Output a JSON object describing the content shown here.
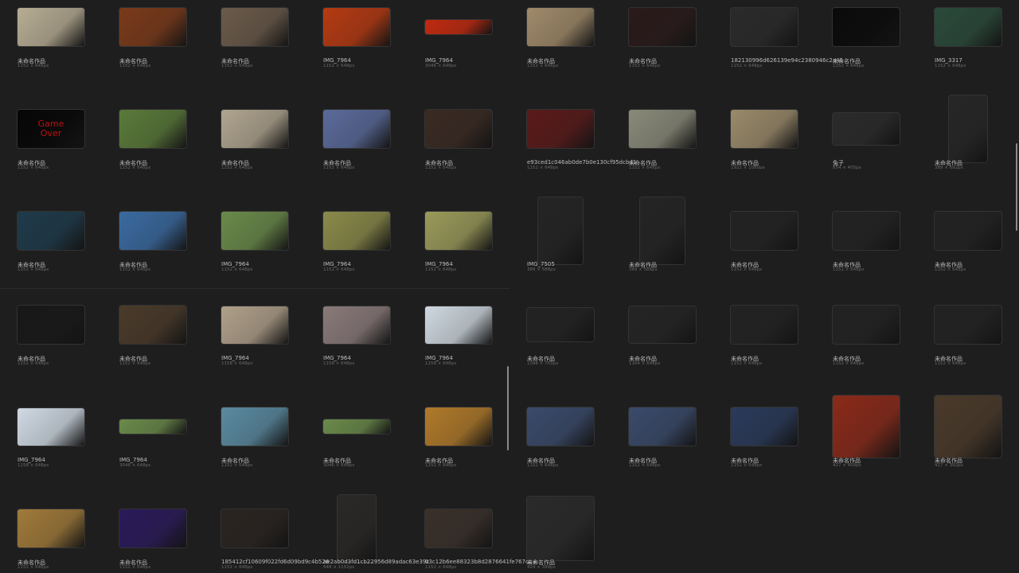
{
  "left_pane": {
    "rows": [
      [
        {
          "name": "未命名作品",
          "dims": "1152 × 648px",
          "color": "#b7ad94"
        },
        {
          "name": "未命名作品",
          "dims": "1152 × 648px",
          "color": "#7a3a1a"
        },
        {
          "name": "未命名作品",
          "dims": "1152 × 648px",
          "color": "#6a5a4a"
        },
        {
          "name": "IMG_7964",
          "dims": "1152 × 648px",
          "color": "#b53a12"
        },
        {
          "name": "IMG_7964",
          "dims": "3046 × 648px",
          "color": "#c02a10"
        }
      ],
      [
        {
          "name": "未命名作品",
          "dims": "1152 × 648px",
          "color": "#060606",
          "caption": "Game\nOver"
        },
        {
          "name": "未命名作品",
          "dims": "1152 × 648px",
          "color": "#5a7a3a"
        },
        {
          "name": "未命名作品",
          "dims": "1152 × 648px",
          "color": "#b0a590"
        },
        {
          "name": "未命名作品",
          "dims": "1152 × 648px",
          "color": "#5a6a9a"
        },
        {
          "name": "未命名作品",
          "dims": "1152 × 648px",
          "color": "#3a2a22"
        }
      ],
      [
        {
          "name": "未命名作品",
          "dims": "1152 × 648px",
          "color": "#1e3a4a"
        },
        {
          "name": "未命名作品",
          "dims": "1152 × 648px",
          "color": "#3a6aa0"
        },
        {
          "name": "IMG_7964",
          "dims": "1152 × 648px",
          "color": "#6a8a4a"
        },
        {
          "name": "IMG_7964",
          "dims": "1152 × 648px",
          "color": "#8a8a4a"
        },
        {
          "name": "IMG_7964",
          "dims": "1152 × 648px",
          "color": "#9a9a5a"
        }
      ],
      [
        {
          "name": "未命名作品",
          "dims": "1152 × 648px",
          "color": "#181818"
        },
        {
          "name": "未命名作品",
          "dims": "1152 × 648px",
          "color": "#4a3a2a"
        },
        {
          "name": "IMG_7964",
          "dims": "1158 × 648px",
          "color": "#b0a08a"
        },
        {
          "name": "IMG_7964",
          "dims": "1158 × 648px",
          "color": "#8a7a7a"
        },
        {
          "name": "IMG_7964",
          "dims": "1158 × 648px",
          "color": "#cfd8e0"
        }
      ],
      [
        {
          "name": "IMG_7964",
          "dims": "1158 × 648px",
          "color": "#d0dae4"
        },
        {
          "name": "IMG_7964",
          "dims": "3046 × 648px",
          "color": "#6a8a4a"
        },
        {
          "name": "未命名作品",
          "dims": "1152 × 648px",
          "color": "#5a8aa0"
        },
        {
          "name": "未命名作品",
          "dims": "3046 × 648px",
          "color": "#6a8a4a"
        },
        {
          "name": "未命名作品",
          "dims": "1152 × 648px",
          "color": "#b07a2a"
        }
      ],
      [
        {
          "name": "未命名作品",
          "dims": "1152 × 648px",
          "color": "#a07a3a"
        },
        {
          "name": "未命名作品",
          "dims": "1152 × 648px",
          "color": "#2a1a5a"
        },
        {
          "name": "185412cf10609f022fd6d09bd9c4b526",
          "dims": "1152 × 648px",
          "color": "#2a2420"
        },
        {
          "name": "ae2ab0d3fd1cb22956d89adac63e39c",
          "dims": "648 × 1152px",
          "color": "#2a2826"
        },
        {
          "name": "03c12b6ee88323b8d2876641fe767d29",
          "dims": "1152 × 648px",
          "color": "#3a302a"
        }
      ]
    ]
  },
  "right_pane": {
    "rows": [
      [
        {
          "name": "未命名作品",
          "dims": "1152 × 648px",
          "color": "#a08a6a"
        },
        {
          "name": "未命名作品",
          "dims": "1152 × 648px",
          "color": "#2a1a1a"
        },
        {
          "name": "182130996d626139e94c2380946c2a40",
          "dims": "1152 × 648px",
          "color": "#2a2a2a"
        },
        {
          "name": "未命名作品",
          "dims": "1152 × 648px",
          "color": "#0a0a0a"
        },
        {
          "name": "IMG_3317",
          "dims": "1152 × 648px",
          "color": "#2a4a3a"
        }
      ],
      [
        {
          "name": "e93ced1c046ab0de7b0e130cf95dcbd1",
          "dims": "1152 × 648px",
          "color": "#5a1a1a"
        },
        {
          "name": "未命名作品",
          "dims": "1152 × 648px",
          "color": "#8a8a7a"
        },
        {
          "name": "未命名作品",
          "dims": "1922 × 1080px",
          "color": "#9a8a6a"
        },
        {
          "name": "兔子",
          "dims": "854 × 405px",
          "color": "#2a2a2a"
        },
        {
          "name": "未命名作品",
          "dims": "389 × 692px",
          "color": "#262626"
        }
      ],
      [
        {
          "name": "IMG_7505",
          "dims": "389 × 588px",
          "color": "#242424"
        },
        {
          "name": "未命名作品",
          "dims": "389 × 588px",
          "color": "#242424"
        },
        {
          "name": "未命名作品",
          "dims": "1152 × 648px",
          "color": "#222222"
        },
        {
          "name": "未命名作品",
          "dims": "1152 × 648px",
          "color": "#222222"
        },
        {
          "name": "未命名作品",
          "dims": "1152 × 648px",
          "color": "#222222"
        }
      ],
      [
        {
          "name": "未命名作品",
          "dims": "1398 × 703px",
          "color": "#222222"
        },
        {
          "name": "未命名作品",
          "dims": "1164 × 648px",
          "color": "#242424"
        },
        {
          "name": "未命名作品",
          "dims": "1152 × 648px",
          "color": "#222222"
        },
        {
          "name": "未命名作品",
          "dims": "1152 × 648px",
          "color": "#222222"
        },
        {
          "name": "未命名作品",
          "dims": "1152 × 648px",
          "color": "#222222"
        }
      ],
      [
        {
          "name": "未命名作品",
          "dims": "1152 × 648px",
          "color": "#3a4a6a"
        },
        {
          "name": "未命名作品",
          "dims": "1152 × 648px",
          "color": "#3a4a6a"
        },
        {
          "name": "未命名作品",
          "dims": "1152 × 648px",
          "color": "#2a3a5a"
        },
        {
          "name": "未命名作品",
          "dims": "427 × 400px",
          "color": "#8a2a1a"
        },
        {
          "name": "未命名作品",
          "dims": "417 × 392px",
          "color": "#4a3a2a"
        }
      ],
      [
        {
          "name": "未命名作品",
          "dims": "424 × 399px",
          "color": "#2a2a2a"
        }
      ]
    ]
  }
}
